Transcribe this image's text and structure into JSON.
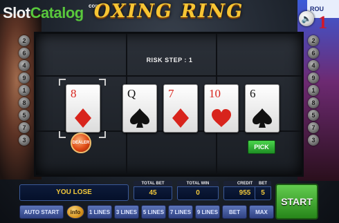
{
  "logo": {
    "slot": "Slot",
    "catalog": "Catalog",
    "com": "com"
  },
  "title": "OXING RING",
  "sound_icon": "speaker-icon",
  "line_indicators": {
    "left": [
      "2",
      "6",
      "4",
      "9",
      "1",
      "8",
      "5",
      "7",
      "3"
    ],
    "right": [
      "2",
      "6",
      "4",
      "9",
      "1",
      "8",
      "5",
      "7",
      "3"
    ]
  },
  "poster": {
    "text": "ROU",
    "number": "1"
  },
  "risk_step": "RISK STEP : 1",
  "cards": [
    {
      "rank": "8",
      "suit": "diamond",
      "color": "#d8241c",
      "dealer": true
    },
    {
      "rank": "Q",
      "suit": "spade",
      "color": "#111111",
      "dealer": false
    },
    {
      "rank": "7",
      "suit": "diamond",
      "color": "#d8241c",
      "dealer": false
    },
    {
      "rank": "10",
      "suit": "heart",
      "color": "#d8241c",
      "dealer": false
    },
    {
      "rank": "6",
      "suit": "spade",
      "color": "#111111",
      "dealer": false
    }
  ],
  "dealer_label": "DEALER",
  "pick_label": "PICK",
  "message": "YOU LOSE",
  "stats": {
    "total_bet": {
      "label": "TOTAL BET",
      "value": "45"
    },
    "total_win": {
      "label": "TOTAL WIN",
      "value": "0"
    },
    "credit": {
      "label": "CREDIT",
      "value": "955"
    },
    "bet": {
      "label": "BET",
      "value": "5"
    }
  },
  "buttons": {
    "auto_start": "AUTO START",
    "info": "info",
    "lines_1": "1 LINES",
    "lines_3": "3 LINES",
    "lines_5": "5 LINES",
    "lines_7": "7 LINES",
    "lines_9": "9 LINES",
    "bet_one": "BET ONE",
    "max_bet": "MAX BET",
    "start": "START"
  },
  "colors": {
    "accent_gold": "#f4c93a",
    "button_blue": "#3f5598",
    "start_green": "#3fa52e"
  }
}
